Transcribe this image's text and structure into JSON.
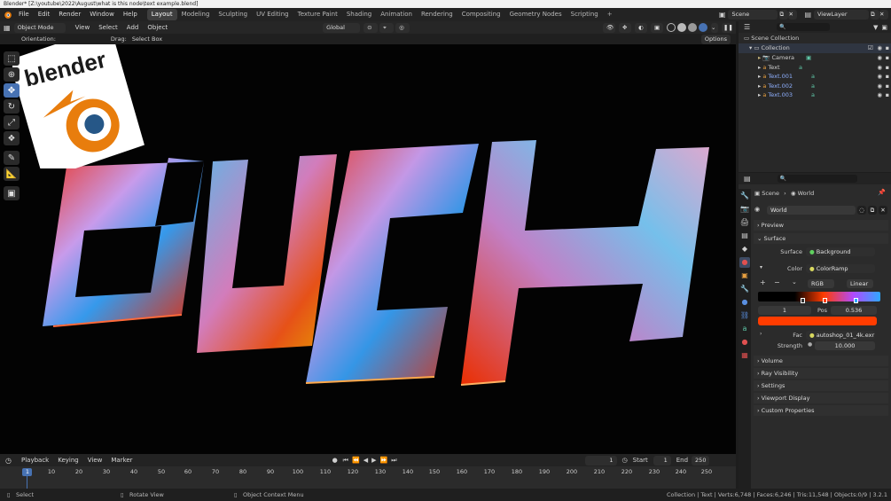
{
  "titlebar": {
    "text": "Blender* [Z:\\youtube\\2022\\August\\what is this node\\text example.blend]"
  },
  "menu": {
    "items": [
      "File",
      "Edit",
      "Render",
      "Window",
      "Help"
    ]
  },
  "workspaces": [
    "Layout",
    "Modeling",
    "Sculpting",
    "UV Editing",
    "Texture Paint",
    "Shading",
    "Animation",
    "Rendering",
    "Compositing",
    "Geometry Nodes",
    "Scripting"
  ],
  "active_workspace": "Layout",
  "scene": {
    "name": "Scene",
    "view_layer": "ViewLayer"
  },
  "viewport_header": {
    "mode": "Object Mode",
    "menus": [
      "View",
      "Select",
      "Add",
      "Object"
    ],
    "transform_orientation": "Global",
    "options": "Options"
  },
  "tool_settings": {
    "orientation_label": "Orientation:",
    "drag_label": "Drag:",
    "drag_value": "Select Box"
  },
  "viewport": {
    "logo_text": "blender",
    "scene_text": "DUCK"
  },
  "outliner": {
    "root": "Scene Collection",
    "collection": "Collection",
    "items": [
      "Camera",
      "Text",
      "Text.001",
      "Text.002",
      "Text.003"
    ]
  },
  "properties": {
    "breadcrumb_scene": "Scene",
    "breadcrumb_world": "World",
    "world_name": "World",
    "panels": {
      "preview": "Preview",
      "surface": "Surface",
      "volume": "Volume",
      "ray_visibility": "Ray Visibility",
      "settings": "Settings",
      "viewport_display": "Viewport Display",
      "custom_properties": "Custom Properties"
    },
    "surface_label": "Surface",
    "surface_value": "Background",
    "color_label": "Color",
    "color_value": "ColorRamp",
    "ramp_mode": "RGB",
    "ramp_interp": "Linear",
    "stop_index": "1",
    "pos_label": "Pos",
    "pos_value": "0.536",
    "stop_color": "#ff3c00",
    "fac_label": "Fac",
    "fac_value": "autoshop_01_4k.exr",
    "strength_label": "Strength",
    "strength_value": "10.000"
  },
  "timeline": {
    "menus": [
      "Playback",
      "Keying",
      "View",
      "Marker"
    ],
    "current_frame": "1",
    "start_label": "Start",
    "start_value": "1",
    "end_label": "End",
    "end_value": "250",
    "ticks": [
      "1",
      "10",
      "20",
      "30",
      "40",
      "50",
      "60",
      "70",
      "80",
      "90",
      "100",
      "110",
      "120",
      "130",
      "140",
      "150",
      "160",
      "170",
      "180",
      "190",
      "200",
      "210",
      "220",
      "230",
      "240",
      "250"
    ]
  },
  "statusbar": {
    "select": "Select",
    "rotate": "Rotate View",
    "context": "Object Context Menu",
    "stats": "Collection | Text | Verts:6,748 | Faces:6,246 | Tris:11,548 | Objects:0/9 | 3.2.1"
  },
  "colors": {
    "accent": "#4772b3",
    "orange": "#e87d0d",
    "ramp_start": "#000000",
    "ramp_mid": "#ff3c00",
    "ramp_end": "#2ea8ff"
  },
  "icons": [
    "blender-icon",
    "scene-icon",
    "viewlayer-icon",
    "eye-icon",
    "camera-icon",
    "text-icon",
    "world-icon",
    "select-box-icon",
    "cursor-icon",
    "move-icon",
    "rotate-icon",
    "scale-icon",
    "transform-icon",
    "annotate-icon",
    "measure-icon",
    "add-cube-icon"
  ]
}
